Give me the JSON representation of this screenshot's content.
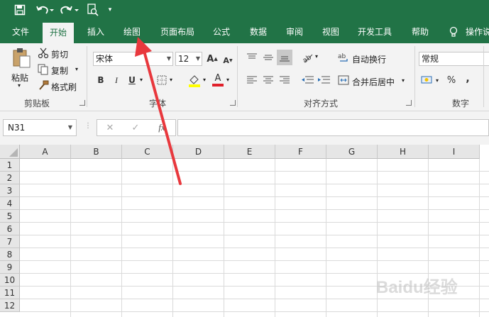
{
  "colors": {
    "brand_green": "#217346",
    "arrow": "#e8383d"
  },
  "qat": {
    "icons": [
      "save-icon",
      "undo-icon",
      "redo-icon",
      "print-preview-icon",
      "customize-icon"
    ]
  },
  "tabs": [
    {
      "label": "文件"
    },
    {
      "label": "开始"
    },
    {
      "label": "插入"
    },
    {
      "label": "绘图"
    },
    {
      "label": "页面布局"
    },
    {
      "label": "公式"
    },
    {
      "label": "数据"
    },
    {
      "label": "审阅"
    },
    {
      "label": "视图"
    },
    {
      "label": "开发工具"
    },
    {
      "label": "帮助"
    },
    {
      "label": "操作说"
    }
  ],
  "active_tab": "开始",
  "clipboard": {
    "paste": "粘贴",
    "cut": "剪切",
    "copy": "复制",
    "format_painter": "格式刷",
    "label": "剪贴板"
  },
  "font": {
    "name": "宋体",
    "size": "12",
    "bold": "B",
    "italic": "I",
    "underline": "U",
    "grow": "A",
    "shrink": "A",
    "font_color": "A",
    "label": "字体"
  },
  "alignment": {
    "wrap": "自动换行",
    "merge": "合并后居中",
    "label": "对齐方式"
  },
  "number": {
    "format": "常规",
    "percent": "%",
    "comma": ",",
    "label": "数字"
  },
  "namebox": {
    "value": "N31"
  },
  "formula_bar": {
    "fx": "fx",
    "cancel": "✕",
    "enter": "✓"
  },
  "grid": {
    "columns": [
      "A",
      "B",
      "C",
      "D",
      "E",
      "F",
      "G",
      "H",
      "I"
    ],
    "rows": [
      "1",
      "2",
      "3",
      "4",
      "5",
      "6",
      "7",
      "8",
      "9",
      "10",
      "11",
      "12"
    ]
  },
  "watermark": {
    "text": "Baidu经验"
  }
}
